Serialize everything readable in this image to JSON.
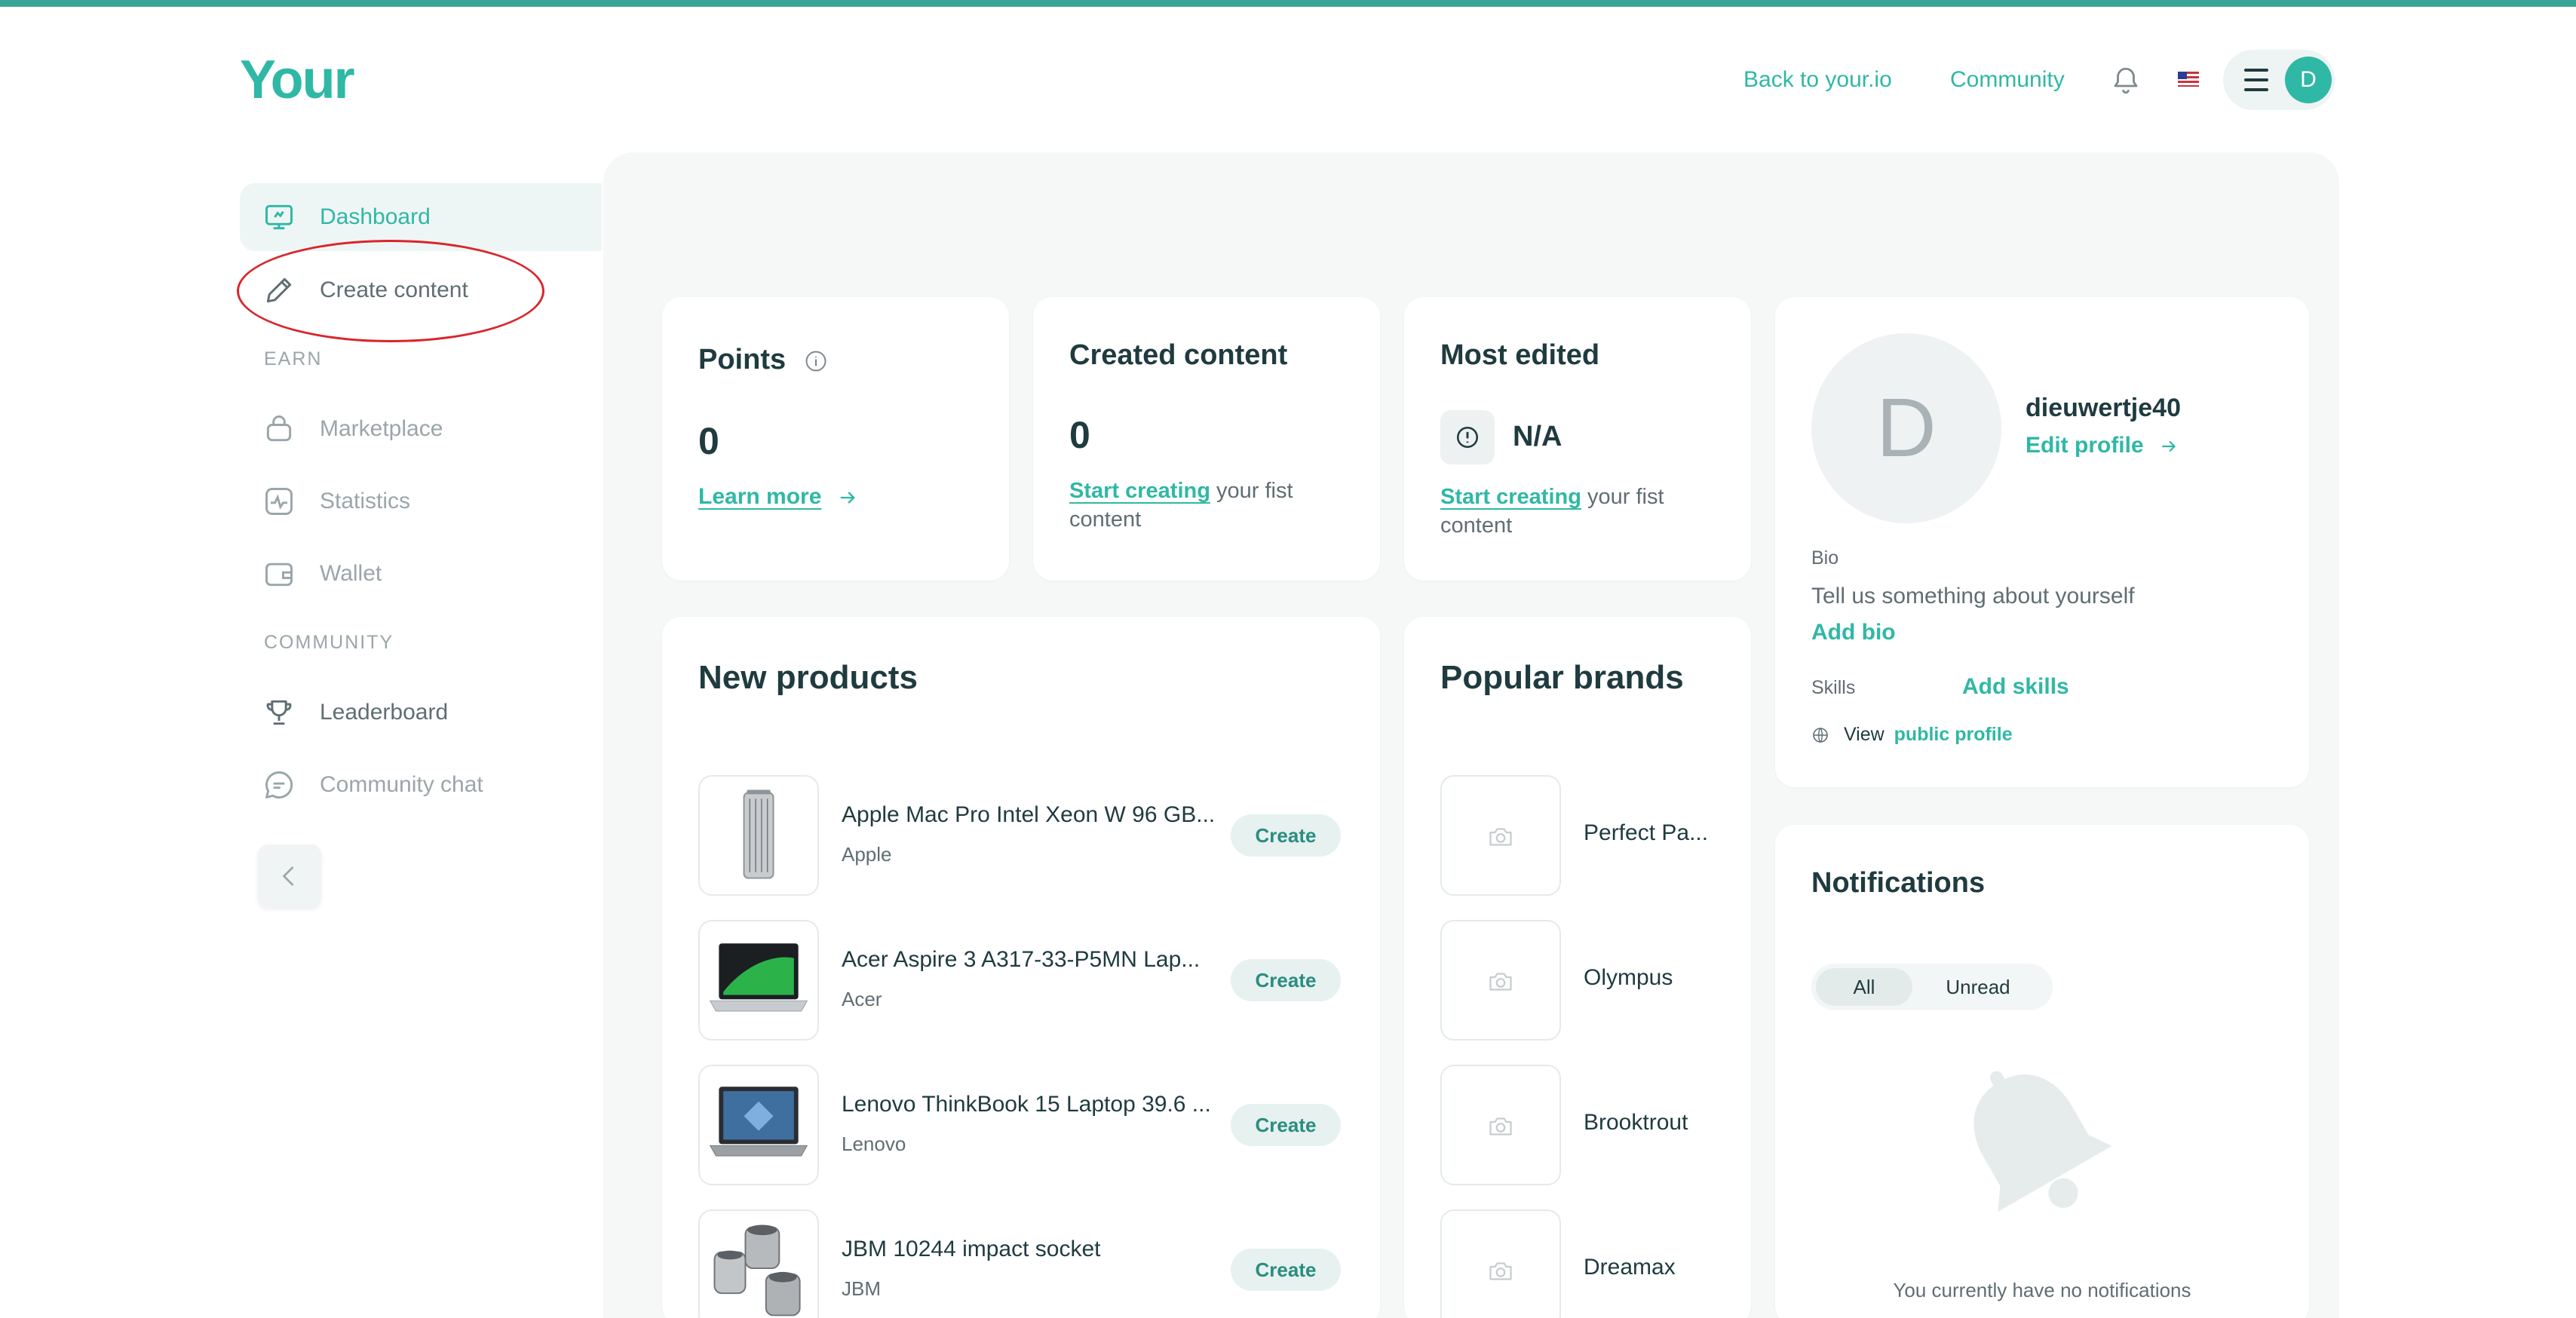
{
  "header": {
    "logo": "Your",
    "back_link": "Back to your.io",
    "community_link": "Community",
    "avatar_letter": "D"
  },
  "sidebar": {
    "items": [
      {
        "label": "Dashboard",
        "icon": "dashboard-icon"
      },
      {
        "label": "Create content",
        "icon": "pencil-icon"
      },
      {
        "label": "Marketplace",
        "icon": "basket-icon"
      },
      {
        "label": "Statistics",
        "icon": "pulse-icon"
      },
      {
        "label": "Wallet",
        "icon": "wallet-icon"
      },
      {
        "label": "Leaderboard",
        "icon": "trophy-icon"
      },
      {
        "label": "Community chat",
        "icon": "chat-icon"
      }
    ],
    "section_earn": "EARN",
    "section_community": "COMMUNITY"
  },
  "points": {
    "title": "Points",
    "value": "0",
    "link": "Learn more"
  },
  "created": {
    "title": "Created content",
    "value": "0",
    "link": "Start creating",
    "rest": " your fist content"
  },
  "most_edited": {
    "title": "Most edited",
    "value": "N/A",
    "link": "Start creating",
    "rest": " your fist content"
  },
  "profile": {
    "avatar_letter": "D",
    "username": "dieuwertje40",
    "edit": "Edit profile",
    "bio_label": "Bio",
    "bio_text": "Tell us something about yourself",
    "add_bio": "Add bio",
    "skills_label": "Skills",
    "add_skills": "Add skills",
    "view": "View",
    "public_profile": "public profile"
  },
  "new_products": {
    "title": "New products",
    "create_label": "Create",
    "items": [
      {
        "name": "Apple Mac Pro Intel Xeon W 96 GB...",
        "brand": "Apple"
      },
      {
        "name": "Acer Aspire 3 A317-33-P5MN Lap...",
        "brand": "Acer"
      },
      {
        "name": "Lenovo ThinkBook 15 Laptop 39.6 ...",
        "brand": "Lenovo"
      },
      {
        "name": "JBM 10244 impact socket",
        "brand": "JBM"
      }
    ]
  },
  "popular_brands": {
    "title": "Popular brands",
    "items": [
      "Perfect Pa...",
      "Olympus",
      "Brooktrout",
      "Dreamax"
    ]
  },
  "notifications": {
    "title": "Notifications",
    "tab_all": "All",
    "tab_unread": "Unread",
    "empty": "You currently have no notifications"
  },
  "colors": {
    "accent": "#2fb8a5",
    "annotation": "#d9262c"
  }
}
